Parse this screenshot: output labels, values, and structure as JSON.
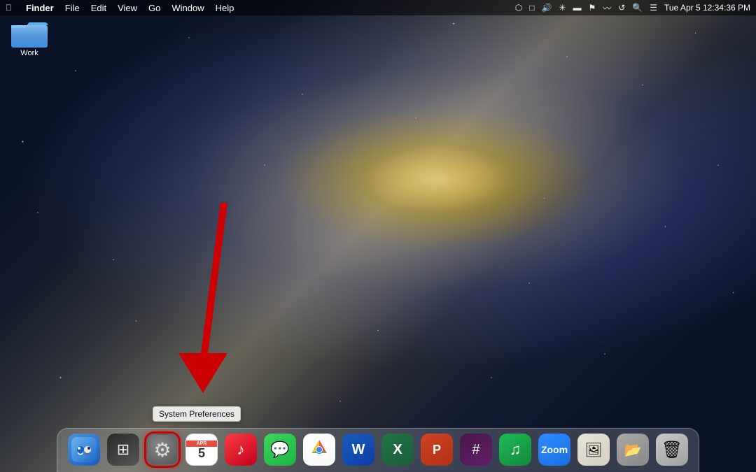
{
  "menubar": {
    "apple_symbol": "",
    "app_name": "Finder",
    "menus": [
      "File",
      "Edit",
      "View",
      "Go",
      "Window",
      "Help"
    ],
    "right_items": [
      "dropbox",
      "bluetooth_icon",
      "volume_icon",
      "bluetooth2",
      "battery",
      "flag",
      "wifi",
      "clock_icons",
      "search",
      "notification",
      "control"
    ],
    "datetime": "Tue Apr 5  12:34:36 PM"
  },
  "desktop": {
    "folder_label": "Work",
    "folder_icon": "📁"
  },
  "tooltip": {
    "text": "System Preferences"
  },
  "dock": {
    "items": [
      {
        "name": "Finder",
        "type": "finder"
      },
      {
        "name": "Launchpad",
        "type": "launchpad"
      },
      {
        "name": "System Preferences",
        "type": "sysprefs",
        "highlighted": true
      },
      {
        "name": "Calendar",
        "type": "calendar"
      },
      {
        "name": "Music",
        "type": "music"
      },
      {
        "name": "Messages",
        "type": "messages"
      },
      {
        "name": "Google Chrome",
        "type": "chrome"
      },
      {
        "name": "Microsoft Word",
        "type": "word"
      },
      {
        "name": "Microsoft Excel",
        "type": "excel"
      },
      {
        "name": "Microsoft PowerPoint",
        "type": "ppt"
      },
      {
        "name": "Slack",
        "type": "slack"
      },
      {
        "name": "Spotify",
        "type": "spotify"
      },
      {
        "name": "Zoom",
        "type": "zoom"
      },
      {
        "name": "Preview",
        "type": "preview"
      },
      {
        "name": "Finder 2",
        "type": "finder2"
      },
      {
        "name": "Trash",
        "type": "trash"
      }
    ]
  },
  "annotation": {
    "arrow_color": "#cc0000",
    "tooltip_text": "System Preferences"
  }
}
